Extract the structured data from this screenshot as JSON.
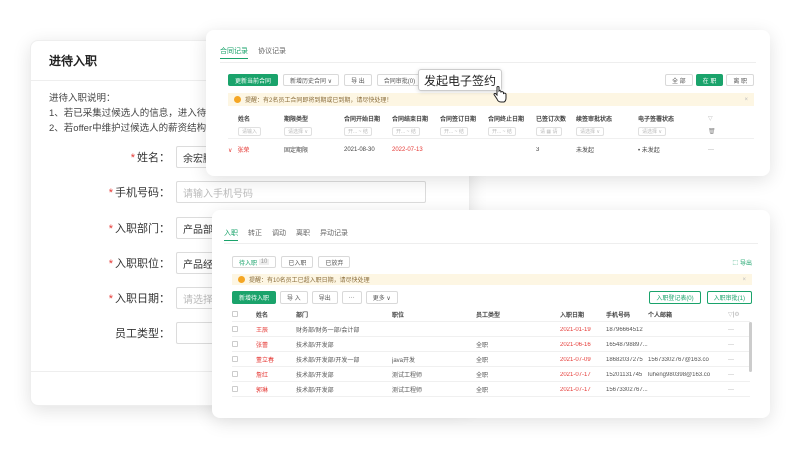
{
  "form": {
    "title": "进待入职",
    "notes": [
      "进待入职说明：",
      "1、若已采集过候选人的信息，进入待入",
      "2、若offer中维护过候选人的薪资结构，"
    ],
    "fields": [
      {
        "label": "姓名：",
        "required": true,
        "value": "余宏鹏",
        "placeholder": ""
      },
      {
        "label": "手机号码：",
        "required": true,
        "value": "",
        "placeholder": "请输入手机号码"
      },
      {
        "label": "入职部门：",
        "required": true,
        "value": "产品部",
        "placeholder": ""
      },
      {
        "label": "入职职位：",
        "required": true,
        "value": "产品经理",
        "placeholder": ""
      },
      {
        "label": "入职日期：",
        "required": true,
        "value": "",
        "placeholder": "请选择日期"
      },
      {
        "label": "员工类型：",
        "required": false,
        "value": "",
        "placeholder": ""
      }
    ]
  },
  "contract": {
    "tabs": [
      "合同记录",
      "协议记录"
    ],
    "buttons": [
      "更新当前合同",
      "新增历史合同 ∨",
      "导 出",
      "合同审批(0)"
    ],
    "status_filters": [
      "全 部",
      "在 职",
      "离 职"
    ],
    "notice": "提醒：有2名员工合同即将到期或已到期，请尽快处理！",
    "columns": [
      "姓名",
      "期限类型",
      "合同开始日期",
      "合同结束日期",
      "合同签订日期",
      "合同终止日期",
      "已签订次数",
      "续签审批状态",
      "电子签署状态"
    ],
    "filters": [
      "请输入",
      "请选择 ∨",
      "开... ~ 结",
      "开... ~ 结",
      "开... ~ 结",
      "开... ~ 结",
      "请 ▦ 请",
      "请选择 ∨",
      "请选择 ∨"
    ],
    "row": {
      "name": "张荣",
      "term": "固定期限",
      "start": "2021-08-30",
      "end": "2022-07-13",
      "count": "3",
      "approval": "未发起",
      "esign": "• 未发起"
    },
    "tooltip": "发起电子签约"
  },
  "onboard": {
    "tabs": [
      "入职",
      "转正",
      "调动",
      "离职",
      "异动记录"
    ],
    "subtabs": [
      "待入职",
      "已入职",
      "已放弃"
    ],
    "subtab_badge": "10",
    "export_link": "导出",
    "notice": "提醒：有10名员工已超入职日期，请尽快处理",
    "actions": [
      "新增待入职",
      "导 入",
      "导出",
      "···",
      "更多 ∨"
    ],
    "right_actions": [
      "入职登记表(0)",
      "入职审批(1)"
    ],
    "columns": [
      "姓名",
      "部门",
      "职位",
      "员工类型",
      "入职日期",
      "手机号码",
      "个人邮箱"
    ],
    "rows": [
      {
        "name": "王辰",
        "dept": "财务部/财务一部/会计部",
        "pos": "",
        "type": "",
        "date": "2021-01-19",
        "phone": "18796664512",
        "email": ""
      },
      {
        "name": "张蕾",
        "dept": "技术部/开发部",
        "pos": "",
        "type": "全职",
        "date": "2021-06-16",
        "phone": "16548798897...",
        "email": ""
      },
      {
        "name": "董立春",
        "dept": "技术部/开发部/开发一部",
        "pos": "java开发",
        "type": "全职",
        "date": "2021-07-09",
        "phone": "18682037275",
        "email": "15673302767@163.co"
      },
      {
        "name": "詹红",
        "dept": "技术部/开发部",
        "pos": "测试工程师",
        "type": "全职",
        "date": "2021-07-17",
        "phone": "15201131745",
        "email": "luheng980398@163.co"
      },
      {
        "name": "郭琳",
        "dept": "技术部/开发部",
        "pos": "测试工程师",
        "type": "全职",
        "date": "2021-07-17",
        "phone": "15673302767...",
        "email": ""
      }
    ]
  }
}
